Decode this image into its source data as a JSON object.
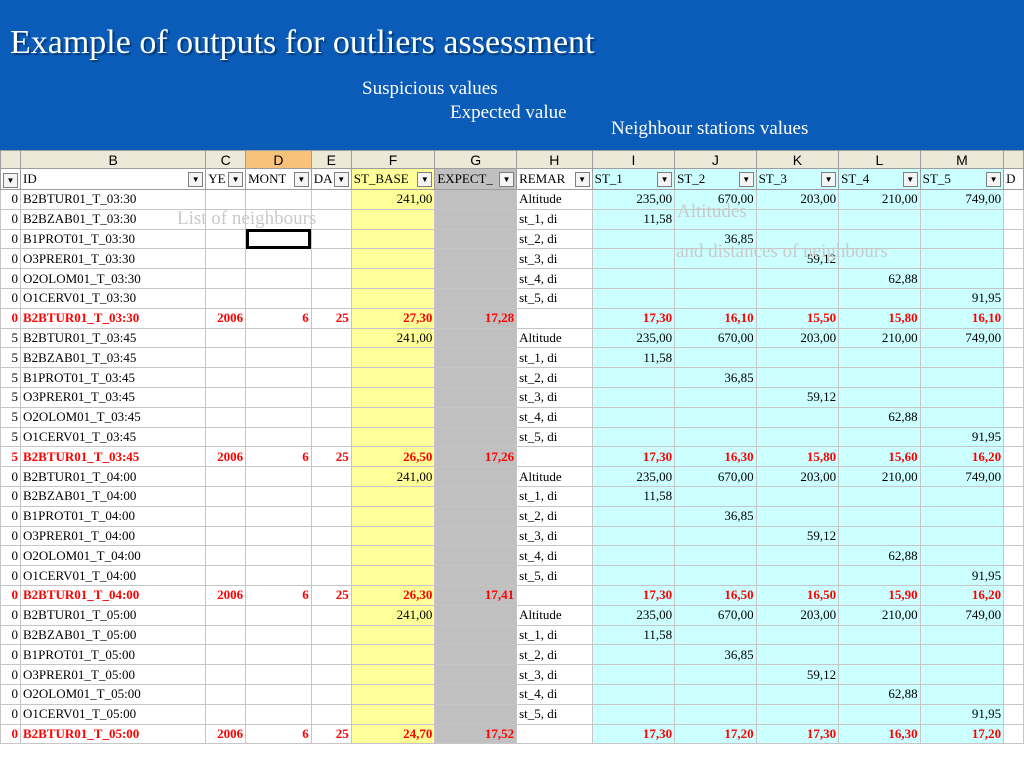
{
  "slide": {
    "title": "Example of outputs for outliers assessment",
    "notes": {
      "suspicious": "Suspicious values",
      "expected": "Expected value",
      "neighbour": "Neighbour stations values",
      "list_neighbours": "List of neighbours",
      "altitudes": "Altitudes",
      "distances": "and distances of neighbours"
    }
  },
  "spreadsheet": {
    "column_letters": [
      "",
      "B",
      "C",
      "D",
      "E",
      "F",
      "G",
      "H",
      "I",
      "J",
      "K",
      "L",
      "M",
      ""
    ],
    "header_labels": [
      "",
      "ID",
      "YE",
      "MONT",
      "DA",
      "ST_BASE",
      "EXPECT_",
      "REMAR",
      "ST_1",
      "ST_2",
      "ST_3",
      "ST_4",
      "ST_5",
      "D"
    ],
    "fill_colors": {
      "base": "#ffff99",
      "expected": "#c0c0c0",
      "neighbours": "#ccffff",
      "outlier_text": "#ff0000",
      "selected_col": "#f8c27a"
    },
    "rows": [
      {
        "cells": [
          "0",
          "B2BTUR01_T_03:30",
          "",
          "",
          "",
          "241,00",
          "",
          "Altitude",
          "235,00",
          "670,00",
          "203,00",
          "210,00",
          "749,00",
          ""
        ]
      },
      {
        "cells": [
          "0",
          "B2BZAB01_T_03:30",
          "",
          "",
          "",
          "",
          "",
          "st_1, di",
          "11,58",
          "",
          "",
          "",
          "",
          ""
        ]
      },
      {
        "cells": [
          "0",
          "B1PROT01_T_03:30",
          "",
          "",
          "",
          "",
          "",
          "st_2, di",
          "",
          "36,85",
          "",
          "",
          "",
          ""
        ]
      },
      {
        "cells": [
          "0",
          "O3PRER01_T_03:30",
          "",
          "",
          "",
          "",
          "",
          "st_3, di",
          "",
          "",
          "59,12",
          "",
          "",
          ""
        ]
      },
      {
        "cells": [
          "0",
          "O2OLOM01_T_03:30",
          "",
          "",
          "",
          "",
          "",
          "st_4, di",
          "",
          "",
          "",
          "62,88",
          "",
          ""
        ]
      },
      {
        "cells": [
          "0",
          "O1CERV01_T_03:30",
          "",
          "",
          "",
          "",
          "",
          "st_5, di",
          "",
          "",
          "",
          "",
          "91,95",
          ""
        ]
      },
      {
        "red": true,
        "cells": [
          "0",
          "B2BTUR01_T_03:30",
          "2006",
          "6",
          "25",
          "27,30",
          "17,28",
          "",
          "17,30",
          "16,10",
          "15,50",
          "15,80",
          "16,10",
          ""
        ]
      },
      {
        "cells": [
          "5",
          "B2BTUR01_T_03:45",
          "",
          "",
          "",
          "241,00",
          "",
          "Altitude",
          "235,00",
          "670,00",
          "203,00",
          "210,00",
          "749,00",
          ""
        ]
      },
      {
        "cells": [
          "5",
          "B2BZAB01_T_03:45",
          "",
          "",
          "",
          "",
          "",
          "st_1, di",
          "11,58",
          "",
          "",
          "",
          "",
          ""
        ]
      },
      {
        "cells": [
          "5",
          "B1PROT01_T_03:45",
          "",
          "",
          "",
          "",
          "",
          "st_2, di",
          "",
          "36,85",
          "",
          "",
          "",
          ""
        ]
      },
      {
        "cells": [
          "5",
          "O3PRER01_T_03:45",
          "",
          "",
          "",
          "",
          "",
          "st_3, di",
          "",
          "",
          "59,12",
          "",
          "",
          ""
        ]
      },
      {
        "cells": [
          "5",
          "O2OLOM01_T_03:45",
          "",
          "",
          "",
          "",
          "",
          "st_4, di",
          "",
          "",
          "",
          "62,88",
          "",
          ""
        ]
      },
      {
        "cells": [
          "5",
          "O1CERV01_T_03:45",
          "",
          "",
          "",
          "",
          "",
          "st_5, di",
          "",
          "",
          "",
          "",
          "91,95",
          ""
        ]
      },
      {
        "red": true,
        "cells": [
          "5",
          "B2BTUR01_T_03:45",
          "2006",
          "6",
          "25",
          "26,50",
          "17,26",
          "",
          "17,30",
          "16,30",
          "15,80",
          "15,60",
          "16,20",
          ""
        ]
      },
      {
        "cells": [
          "0",
          "B2BTUR01_T_04:00",
          "",
          "",
          "",
          "241,00",
          "",
          "Altitude",
          "235,00",
          "670,00",
          "203,00",
          "210,00",
          "749,00",
          ""
        ]
      },
      {
        "cells": [
          "0",
          "B2BZAB01_T_04:00",
          "",
          "",
          "",
          "",
          "",
          "st_1, di",
          "11,58",
          "",
          "",
          "",
          "",
          ""
        ]
      },
      {
        "cells": [
          "0",
          "B1PROT01_T_04:00",
          "",
          "",
          "",
          "",
          "",
          "st_2, di",
          "",
          "36,85",
          "",
          "",
          "",
          ""
        ]
      },
      {
        "cells": [
          "0",
          "O3PRER01_T_04:00",
          "",
          "",
          "",
          "",
          "",
          "st_3, di",
          "",
          "",
          "59,12",
          "",
          "",
          ""
        ]
      },
      {
        "cells": [
          "0",
          "O2OLOM01_T_04:00",
          "",
          "",
          "",
          "",
          "",
          "st_4, di",
          "",
          "",
          "",
          "62,88",
          "",
          ""
        ]
      },
      {
        "cells": [
          "0",
          "O1CERV01_T_04:00",
          "",
          "",
          "",
          "",
          "",
          "st_5, di",
          "",
          "",
          "",
          "",
          "91,95",
          ""
        ]
      },
      {
        "red": true,
        "cells": [
          "0",
          "B2BTUR01_T_04:00",
          "2006",
          "6",
          "25",
          "26,30",
          "17,41",
          "",
          "17,30",
          "16,50",
          "16,50",
          "15,90",
          "16,20",
          ""
        ]
      },
      {
        "cells": [
          "0",
          "B2BTUR01_T_05:00",
          "",
          "",
          "",
          "241,00",
          "",
          "Altitude",
          "235,00",
          "670,00",
          "203,00",
          "210,00",
          "749,00",
          ""
        ]
      },
      {
        "cells": [
          "0",
          "B2BZAB01_T_05:00",
          "",
          "",
          "",
          "",
          "",
          "st_1, di",
          "11,58",
          "",
          "",
          "",
          "",
          ""
        ]
      },
      {
        "cells": [
          "0",
          "B1PROT01_T_05:00",
          "",
          "",
          "",
          "",
          "",
          "st_2, di",
          "",
          "36,85",
          "",
          "",
          "",
          ""
        ]
      },
      {
        "cells": [
          "0",
          "O3PRER01_T_05:00",
          "",
          "",
          "",
          "",
          "",
          "st_3, di",
          "",
          "",
          "59,12",
          "",
          "",
          ""
        ]
      },
      {
        "cells": [
          "0",
          "O2OLOM01_T_05:00",
          "",
          "",
          "",
          "",
          "",
          "st_4, di",
          "",
          "",
          "",
          "62,88",
          "",
          ""
        ]
      },
      {
        "cells": [
          "0",
          "O1CERV01_T_05:00",
          "",
          "",
          "",
          "",
          "",
          "st_5, di",
          "",
          "",
          "",
          "",
          "91,95",
          ""
        ]
      },
      {
        "red": true,
        "cells": [
          "0",
          "B2BTUR01_T_05:00",
          "2006",
          "6",
          "25",
          "24,70",
          "17,52",
          "",
          "17,30",
          "17,20",
          "17,30",
          "16,30",
          "17,20",
          ""
        ]
      }
    ]
  }
}
